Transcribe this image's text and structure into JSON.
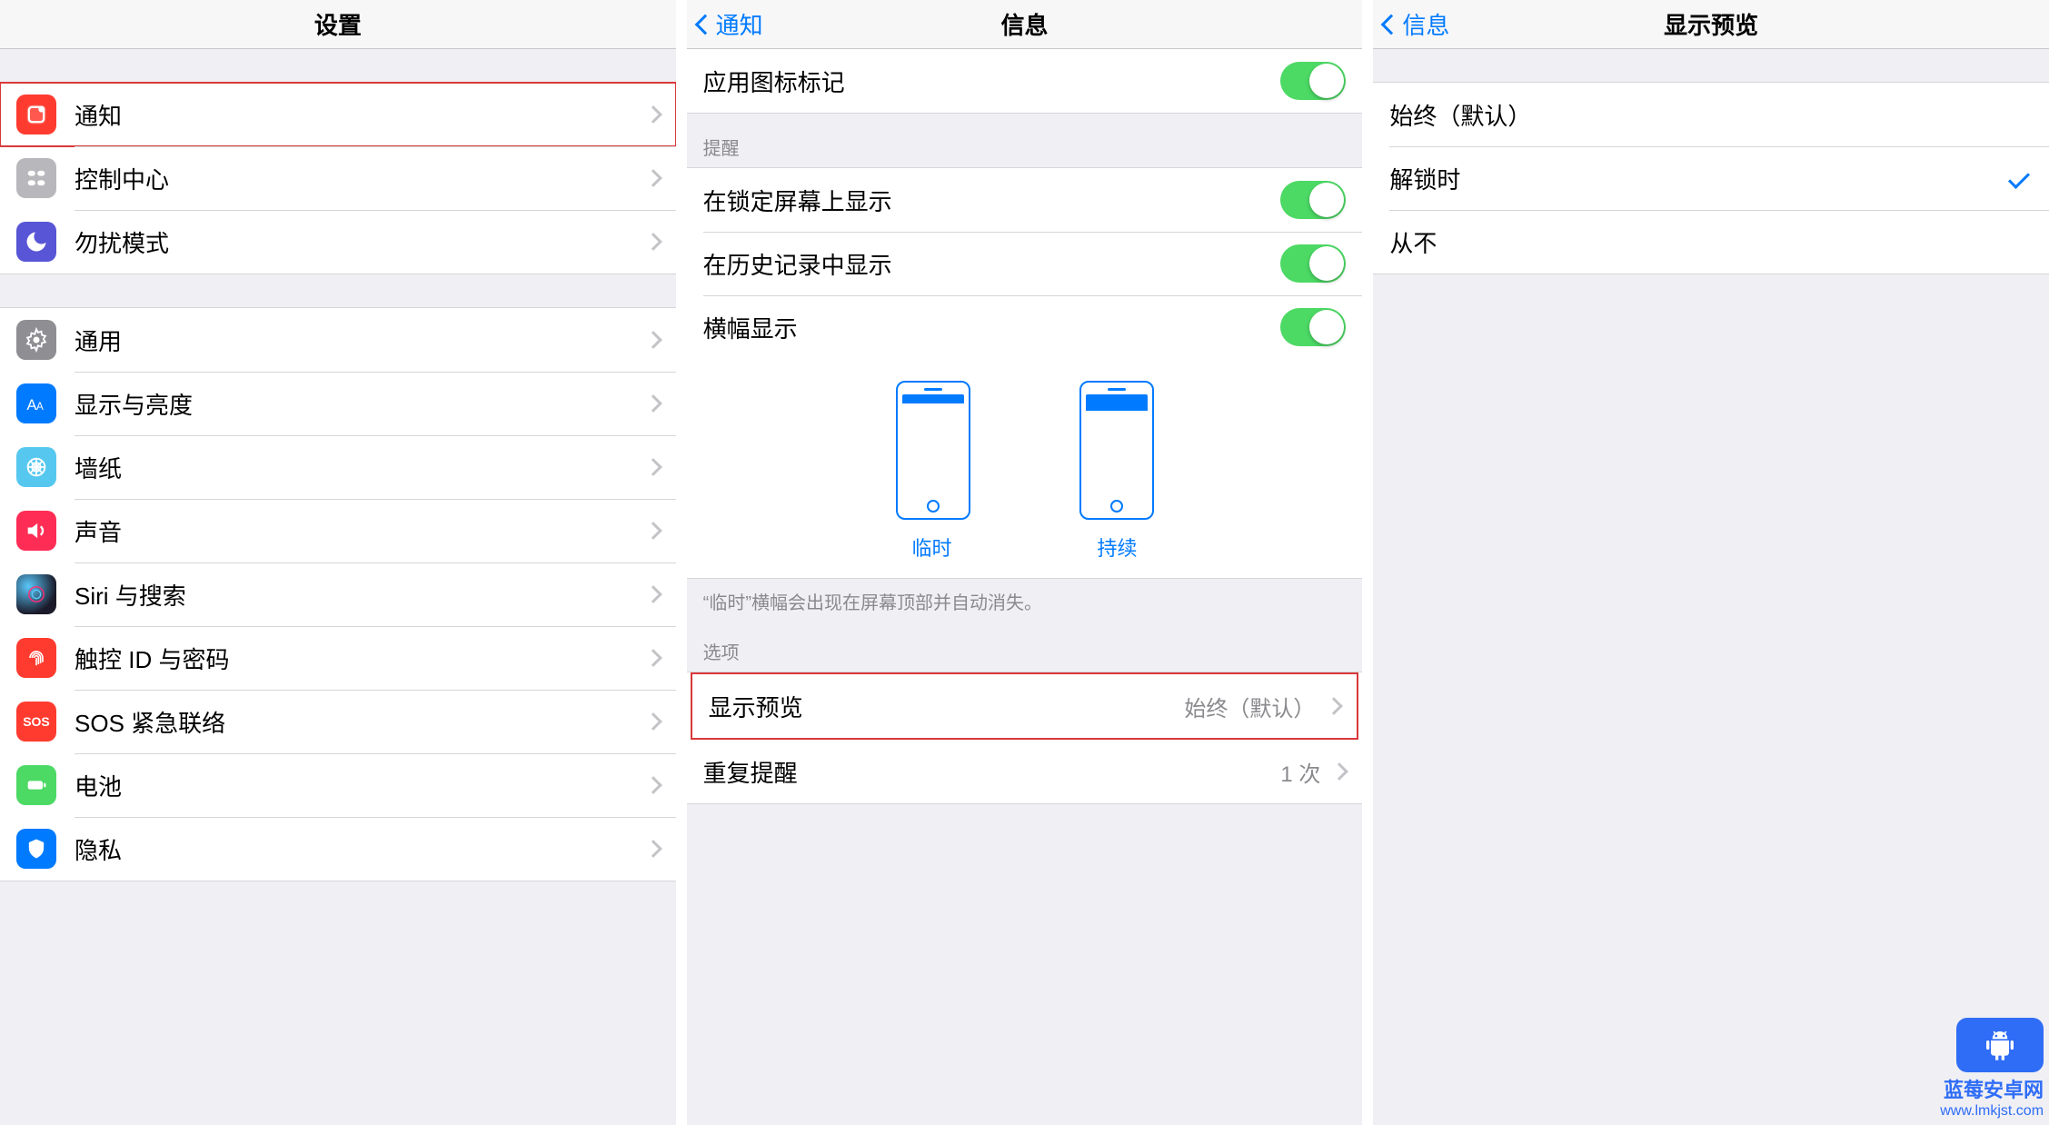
{
  "pane1": {
    "title": "设置",
    "group1": [
      {
        "id": "notifications",
        "label": "通知"
      },
      {
        "id": "control-center",
        "label": "控制中心"
      },
      {
        "id": "dnd",
        "label": "勿扰模式"
      }
    ],
    "group2": [
      {
        "id": "general",
        "label": "通用"
      },
      {
        "id": "display",
        "label": "显示与亮度"
      },
      {
        "id": "wallpaper",
        "label": "墙纸"
      },
      {
        "id": "sounds",
        "label": "声音"
      },
      {
        "id": "siri",
        "label": "Siri 与搜索"
      },
      {
        "id": "touchid",
        "label": "触控 ID 与密码"
      },
      {
        "id": "sos",
        "label": "SOS 紧急联络"
      },
      {
        "id": "battery",
        "label": "电池"
      },
      {
        "id": "privacy",
        "label": "隐私"
      }
    ]
  },
  "pane2": {
    "back": "通知",
    "title": "信息",
    "app_badge_label": "应用图标标记",
    "section_alerts": "提醒",
    "rows_alerts": [
      {
        "label": "在锁定屏幕上显示"
      },
      {
        "label": "在历史记录中显示"
      },
      {
        "label": "横幅显示"
      }
    ],
    "banner_temp": "临时",
    "banner_persist": "持续",
    "footer_banner": "“临时”横幅会出现在屏幕顶部并自动消失。",
    "section_options": "选项",
    "show_preview_label": "显示预览",
    "show_preview_value": "始终（默认）",
    "repeat_label": "重复提醒",
    "repeat_value": "1 次"
  },
  "pane3": {
    "back": "信息",
    "title": "显示预览",
    "options": [
      {
        "label": "始终（默认）",
        "selected": false
      },
      {
        "label": "解锁时",
        "selected": true
      },
      {
        "label": "从不",
        "selected": false
      }
    ]
  },
  "watermark": {
    "line1": "蓝莓安卓网",
    "line2": "www.lmkjst.com"
  },
  "icon_colors": {
    "notifications": "#ff3b30",
    "control-center": "#b8b8bc",
    "dnd": "#5856d6",
    "general": "#8e8e93",
    "display": "#007aff",
    "wallpaper": "#56c8ef",
    "sounds": "#ff2d55",
    "siri": "#1a1a2a",
    "touchid": "#ff3b30",
    "sos": "#ff3b30",
    "battery": "#4cd964",
    "privacy": "#007aff"
  }
}
